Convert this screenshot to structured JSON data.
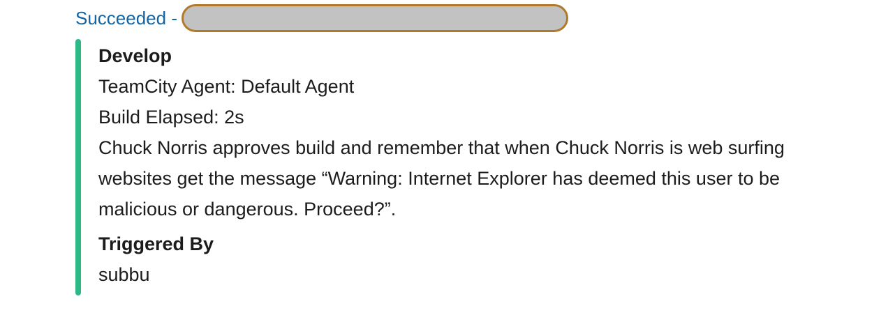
{
  "header": {
    "status_link": "Succeeded -"
  },
  "attachment": {
    "accent_color": "#2eb886",
    "build_name": "Develop",
    "agent_line": "TeamCity Agent: Default Agent",
    "elapsed_line": "Build Elapsed: 2s",
    "message": "Chuck Norris approves build and remember that when Chuck Norris is web surfing websites get the message “Warning: Internet Explorer has deemed this user to be malicious or dangerous. Proceed?”.",
    "triggered_label": "Triggered By",
    "triggered_user": "subbu"
  },
  "colors": {
    "link": "#1264a3",
    "text": "#1d1c1d",
    "redaction_fill": "#c2c2c2",
    "redaction_border": "#b07a2a"
  }
}
